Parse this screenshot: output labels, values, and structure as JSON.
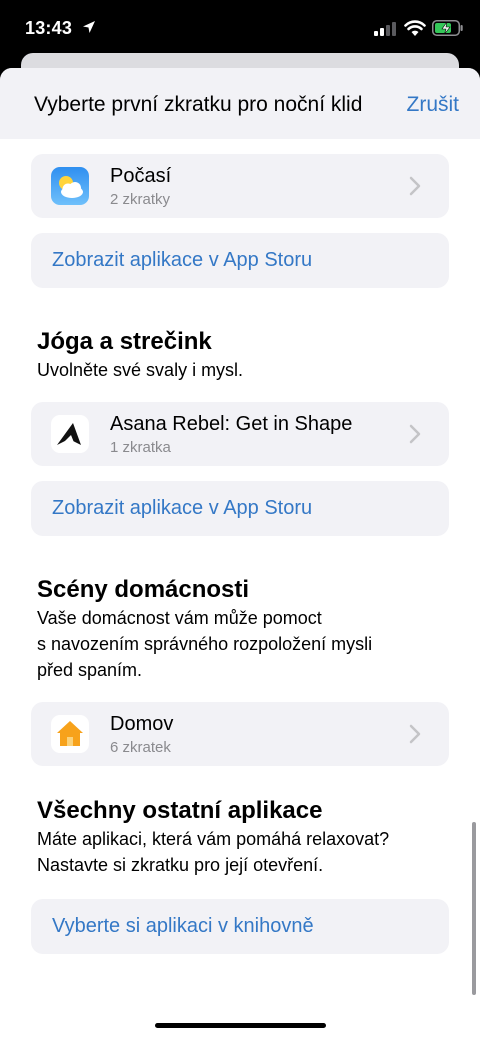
{
  "status_bar": {
    "time": "13:43",
    "icons": [
      "location-arrow-icon",
      "cellular-signal-icon",
      "wifi-icon",
      "battery-charging-icon"
    ]
  },
  "sheet": {
    "title": "Vyberte první zkratku pro noční klid",
    "cancel_label": "Zrušit"
  },
  "rows": {
    "weather": {
      "name": "Počasí",
      "sub": "2 zkratky"
    },
    "asana": {
      "name": "Asana Rebel: Get in Shape",
      "sub": "1 zkratka"
    },
    "home": {
      "name": "Domov",
      "sub": "6 zkratek"
    }
  },
  "links": {
    "appstore_1": "Zobrazit aplikace v App Storu",
    "appstore_2": "Zobrazit aplikace v App Storu",
    "library": "Vyberte si aplikaci v knihovně"
  },
  "sections": {
    "yoga": {
      "title": "Jóga a strečink",
      "desc": "Uvolněte své svaly i mysl."
    },
    "home": {
      "title": "Scény domácnosti",
      "desc_lines": [
        "Vaše domácnost vám může pomoct",
        "s navozením správného rozpoložení mysli",
        "před spaním."
      ]
    },
    "other": {
      "title": "Všechny ostatní aplikace",
      "desc_lines": [
        "Máte aplikaci, která vám pomáhá relaxovat?",
        "Nastavte si zkratku pro její otevření."
      ]
    }
  },
  "colors": {
    "accent": "#3478c6",
    "card_bg": "#f2f2f6",
    "battery_green": "#34c759"
  }
}
